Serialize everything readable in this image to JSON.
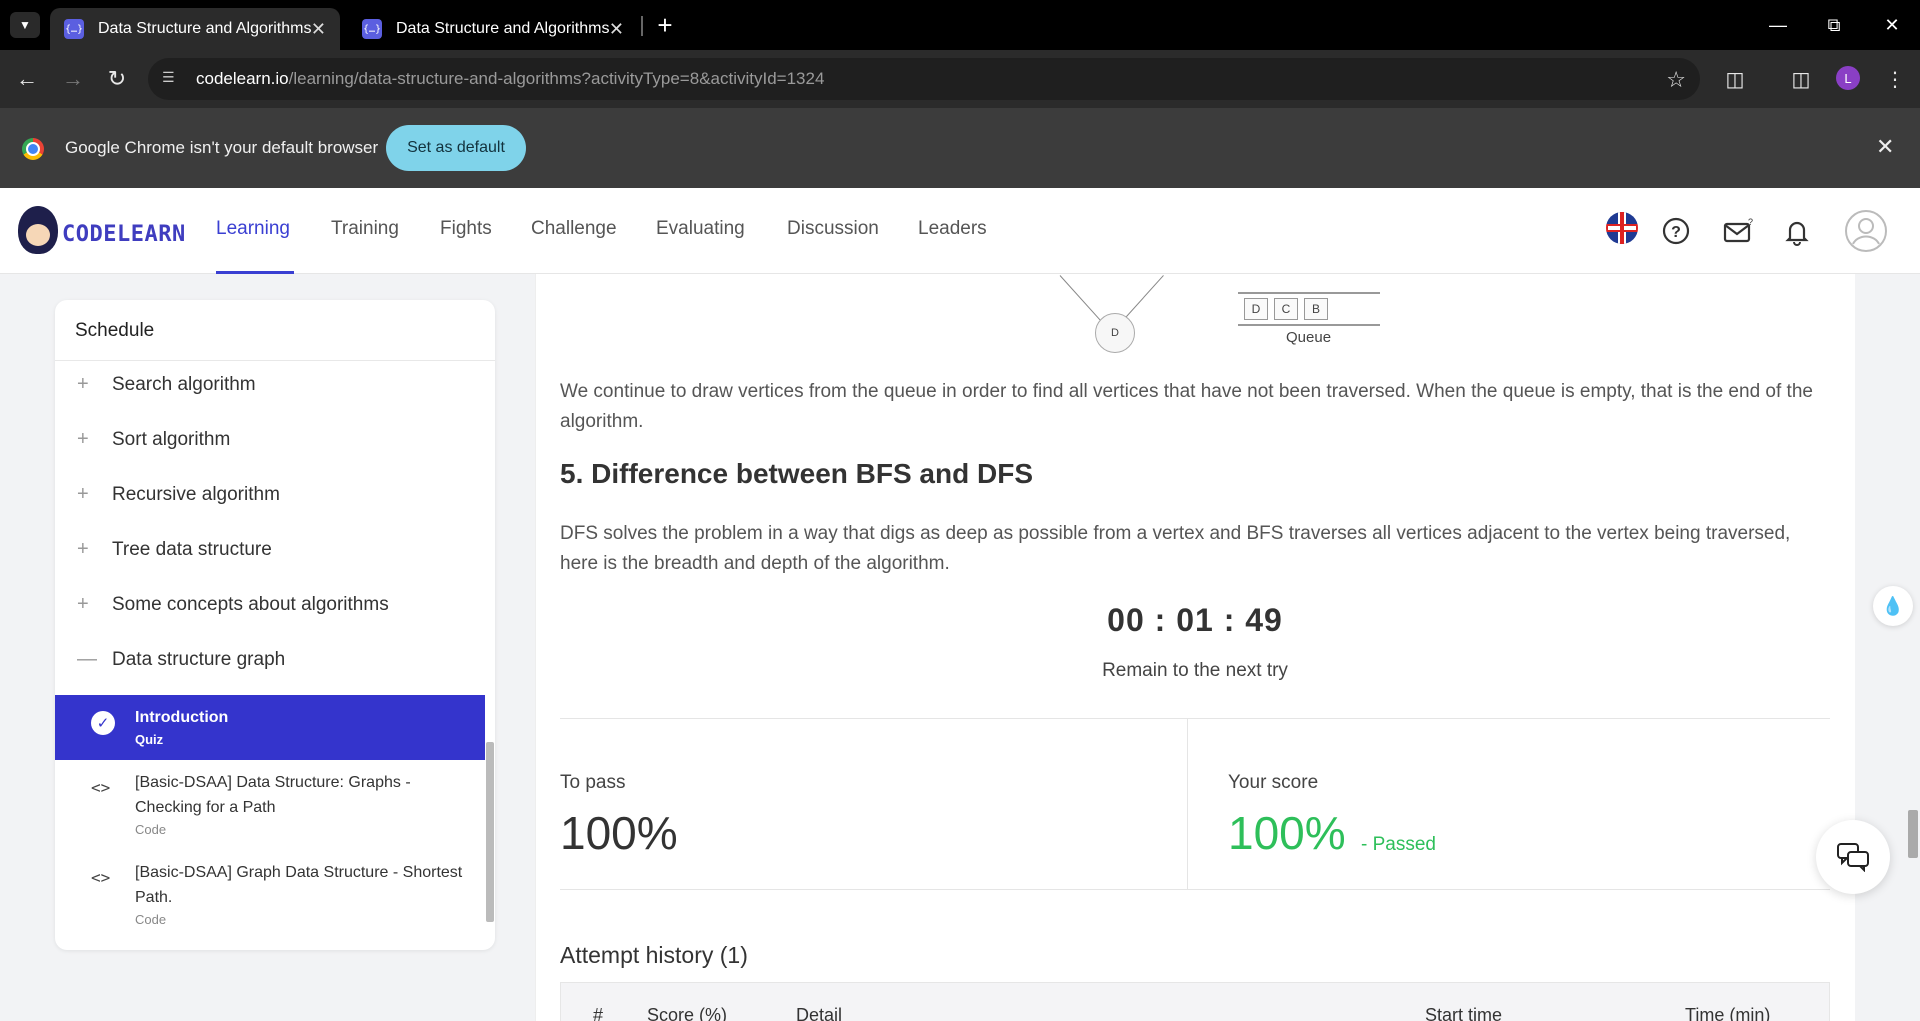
{
  "browser": {
    "tabs": [
      {
        "title": "Data Structure and Algorithms",
        "active": true
      },
      {
        "title": "Data Structure and Algorithms",
        "active": false
      }
    ],
    "url_host": "codelearn.io",
    "url_path": "/learning/data-structure-and-algorithms?activityType=8&activityId=1324",
    "profile_initial": "L",
    "infobar_text": "Google Chrome isn't your default browser",
    "infobar_button": "Set as default"
  },
  "site": {
    "logo_text": "CODELEARN",
    "nav": [
      "Learning",
      "Training",
      "Fights",
      "Challenge",
      "Evaluating",
      "Discussion",
      "Leaders"
    ],
    "active_nav": "Learning",
    "accent_color": "#3a3fd2"
  },
  "sidebar": {
    "title": "Schedule",
    "sections": [
      {
        "label": "Search algorithm",
        "expanded": false
      },
      {
        "label": "Sort algorithm",
        "expanded": false
      },
      {
        "label": "Recursive algorithm",
        "expanded": false
      },
      {
        "label": "Tree data structure",
        "expanded": false
      },
      {
        "label": "Some concepts about algorithms",
        "expanded": false
      },
      {
        "label": "Data structure graph",
        "expanded": true
      }
    ],
    "items": [
      {
        "name": "Introduction",
        "type": "Quiz",
        "active": true,
        "completed": true
      },
      {
        "name": "[Basic-DSAA] Data Structure: Graphs - Checking for a Path",
        "type": "Code",
        "active": false
      },
      {
        "name": "[Basic-DSAA] Graph Data Structure - Shortest Path.",
        "type": "Code",
        "active": false
      }
    ]
  },
  "content": {
    "figure": {
      "node_label": "D",
      "queue_cells": [
        "D",
        "C",
        "B"
      ],
      "queue_label": "Queue"
    },
    "paragraph1": "We continue to draw vertices from the queue in order to find all vertices that have not been traversed. When the queue is empty, that is the end of the algorithm.",
    "heading": "5. Difference between BFS and DFS",
    "paragraph2": "DFS solves the problem in a way that digs as deep as possible from a vertex and BFS traverses all vertices adjacent to the vertex being traversed, here is the breadth and depth of the algorithm.",
    "timer": "00 : 01 : 49",
    "timer_caption": "Remain to the next try",
    "to_pass_label": "To pass",
    "to_pass_value": "100%",
    "your_score_label": "Your score",
    "your_score_value": "100%",
    "result": "- Passed",
    "result_color": "#2ebf5a",
    "attempt_title": "Attempt history (1)",
    "table_headers": [
      "#",
      "Score (%)",
      "Detail",
      "Start time",
      "Time (min)"
    ]
  }
}
